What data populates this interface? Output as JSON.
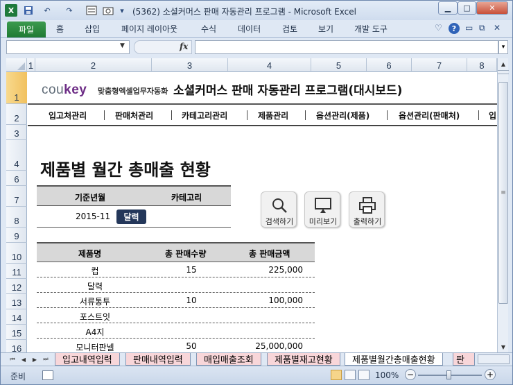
{
  "window": {
    "title": "(5362) 소셜커머스 판매 자동관리 프로그램 - Microsoft Excel",
    "logo": "X",
    "controls": {
      "minimize": "▁",
      "maximize": "□",
      "close": "✕"
    }
  },
  "quick_access": {
    "save": "💾",
    "undo": "↶",
    "redo": "↷"
  },
  "ribbon": {
    "tabs": [
      "파일",
      "홈",
      "삽입",
      "페이지 레이아웃",
      "수식",
      "데이터",
      "검토",
      "보기",
      "개발 도구"
    ],
    "help": "?"
  },
  "formula_bar": {
    "name_box": "",
    "fx": "fx",
    "formula": ""
  },
  "columns": [
    "1",
    "2",
    "3",
    "4",
    "5",
    "6",
    "7",
    "8"
  ],
  "rows": [
    "1",
    "2",
    "3",
    "4",
    "6",
    "7",
    "8",
    "9",
    "10",
    "11",
    "12",
    "13",
    "14",
    "15",
    "16"
  ],
  "header": {
    "logo_prefix": "cou",
    "logo_suffix": "key",
    "logo_tagline": "맞춤형엑셀업무자동화",
    "app_title": "소셜커머스 판매 자동관리 프로그램(대시보드)"
  },
  "nav": [
    "입고처관리",
    "판매처관리",
    "카테고리관리",
    "제품관리",
    "옵션관리(제품)",
    "옵션관리(판매처)",
    "입"
  ],
  "page_title": "제품별 월간 총매출 현황",
  "filter": {
    "col_month": "기준년월",
    "col_category": "카테고리",
    "month_value": "2015-11",
    "calendar_button": "달력"
  },
  "actions": [
    {
      "label": "검색하기",
      "icon": "search-icon"
    },
    {
      "label": "미리보기",
      "icon": "monitor-icon"
    },
    {
      "label": "출력하기",
      "icon": "printer-icon"
    }
  ],
  "table": {
    "headers": [
      "제품명",
      "총 판매수량",
      "총 판매금액"
    ],
    "rows": [
      {
        "name": "컵",
        "qty": "15",
        "amount": "225,000"
      },
      {
        "name": "달력",
        "qty": "",
        "amount": ""
      },
      {
        "name": "서류통투",
        "qty": "10",
        "amount": "100,000"
      },
      {
        "name": "포스트잇",
        "qty": "",
        "amount": ""
      },
      {
        "name": "A4지",
        "qty": "",
        "amount": ""
      },
      {
        "name": "모니터판넬",
        "qty": "50",
        "amount": "25,000,000"
      }
    ]
  },
  "sheet_tabs": [
    "입고내역입력",
    "판매내역입력",
    "매입매출조회",
    "제품별재고현황",
    "제품별월간총매출현황",
    "판"
  ],
  "status": {
    "ready": "준비",
    "zoom": "100%",
    "minus": "−",
    "plus": "+"
  }
}
